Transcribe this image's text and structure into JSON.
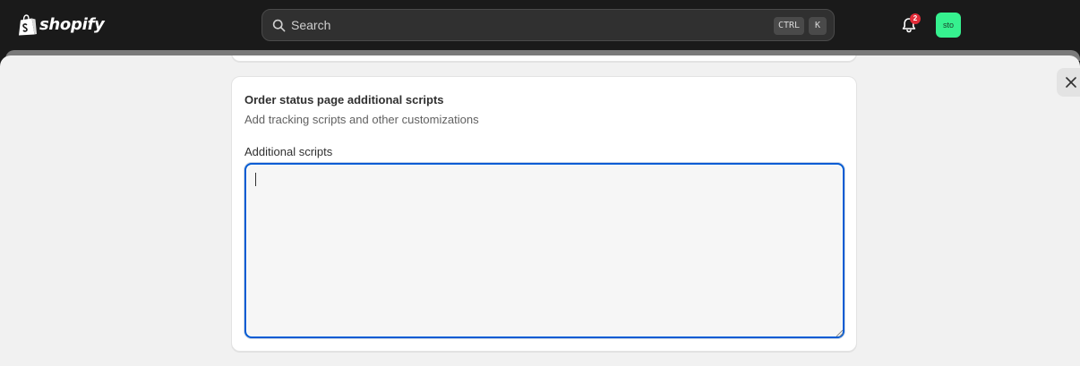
{
  "header": {
    "logo_text": "shopify",
    "search": {
      "placeholder": "Search",
      "shortcut_keys": [
        "CTRL",
        "K"
      ]
    },
    "notifications": {
      "count": "2"
    },
    "avatar": {
      "initials": "sto",
      "color": "#36f18f"
    }
  },
  "modal": {
    "close_icon": "close-icon",
    "card": {
      "title": "Order status page additional scripts",
      "subtitle": "Add tracking scripts and other customizations",
      "field_label": "Additional scripts",
      "field_value": ""
    }
  },
  "colors": {
    "topbar": "#1a1a1a",
    "focus_ring": "#005bd3",
    "badge": "#e22c38"
  }
}
